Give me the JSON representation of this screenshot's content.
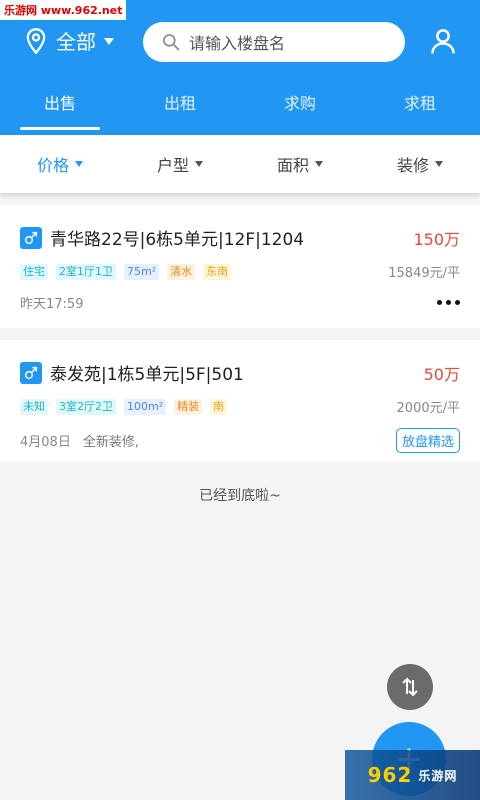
{
  "watermark": "乐游网 www.962.net",
  "header": {
    "city_label": "全部",
    "search_placeholder": "请输入楼盘名",
    "tabs": [
      "出售",
      "出租",
      "求购",
      "求租"
    ],
    "active_tab": 0
  },
  "filters": [
    "价格",
    "户型",
    "面积",
    "装修"
  ],
  "listings": [
    {
      "title": "青华路22号|6栋5单元|12F|1204",
      "price": "150万",
      "tags": [
        "住宅",
        "2室1厅1卫",
        "75m²",
        "清水",
        "东南"
      ],
      "unit_price": "15849元/平",
      "date": "昨天17:59",
      "desc": ""
    },
    {
      "title": "泰发苑|1栋5单元|5F|501",
      "price": "50万",
      "tags": [
        "未知",
        "3室2厅2卫",
        "100m²",
        "精装",
        "南"
      ],
      "unit_price": "2000元/平",
      "date": "4月08日",
      "desc": "全新装修,",
      "badge": "放盘精选"
    }
  ],
  "end_note": "已经到底啦~",
  "icons": {
    "location": "location-pin-icon",
    "search": "search-icon",
    "user": "user-icon",
    "gender": "male-icon",
    "more": "more-dots-icon",
    "sort": "sort-arrows-icon",
    "add": "plus-icon"
  },
  "corner_logo": {
    "main": "962",
    "sub": "乐游网"
  },
  "colors": {
    "primary": "#2196f3",
    "price": "#e64a3b"
  }
}
